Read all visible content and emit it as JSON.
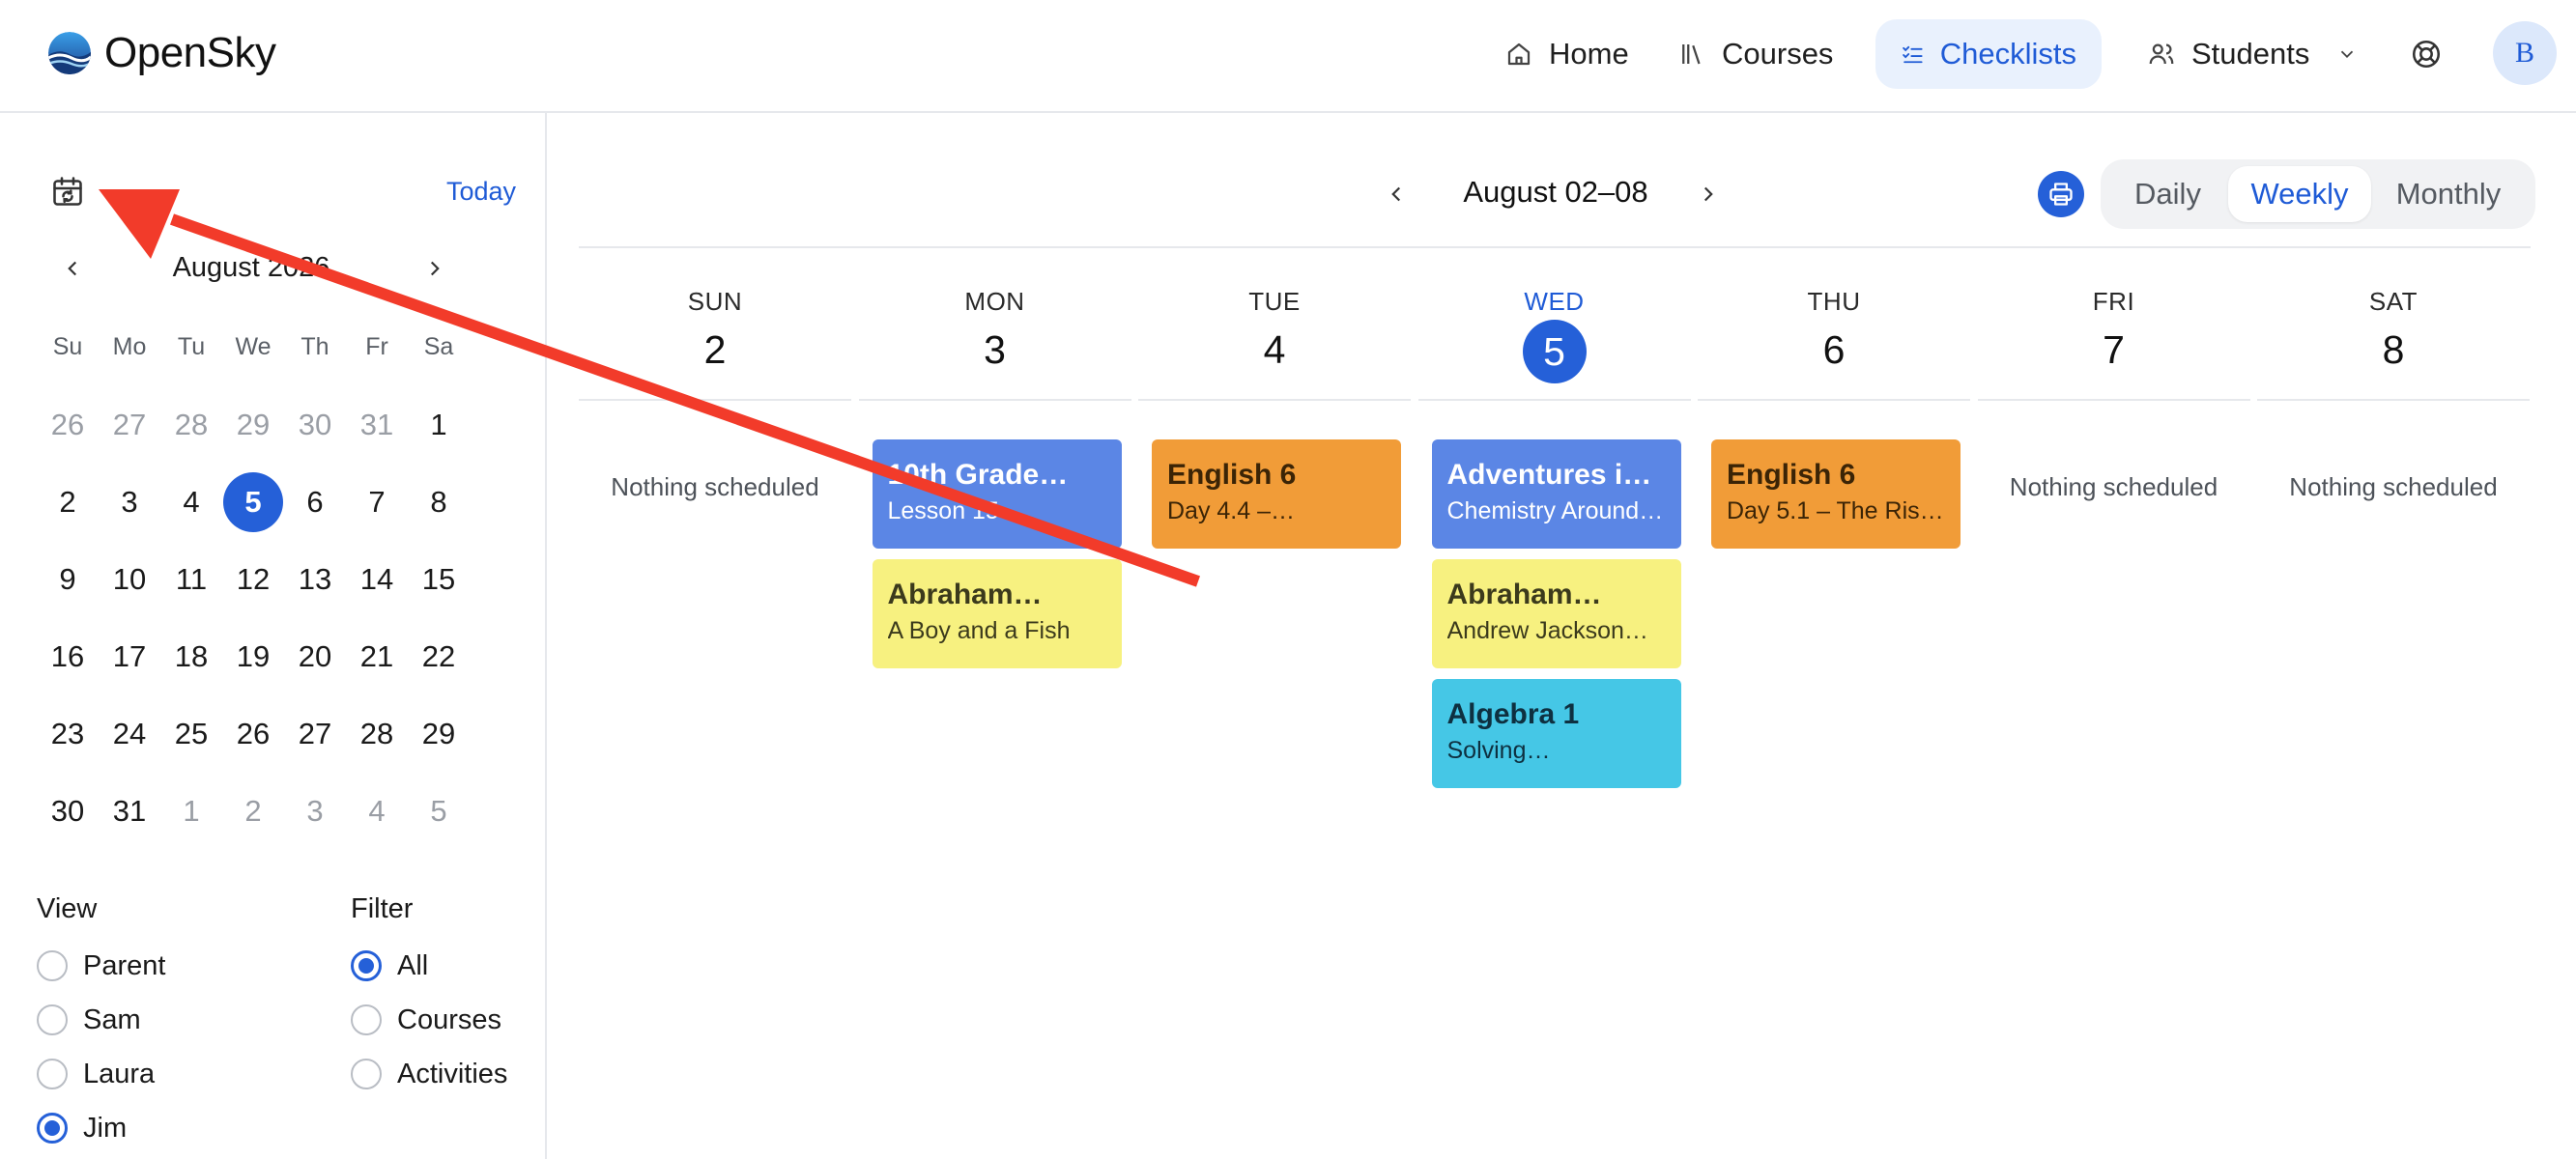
{
  "header": {
    "brand": "OpenSky",
    "nav": {
      "home": "Home",
      "courses": "Courses",
      "checklists": "Checklists",
      "students": "Students"
    },
    "avatar_initial": "B"
  },
  "sidebar": {
    "today_label": "Today",
    "month_title": "August 2026",
    "weekday_headers": [
      "Su",
      "Mo",
      "Tu",
      "We",
      "Th",
      "Fr",
      "Sa"
    ],
    "weeks": [
      [
        {
          "d": "26",
          "muted": true
        },
        {
          "d": "27",
          "muted": true
        },
        {
          "d": "28",
          "muted": true
        },
        {
          "d": "29",
          "muted": true
        },
        {
          "d": "30",
          "muted": true
        },
        {
          "d": "31",
          "muted": true
        },
        {
          "d": "1"
        }
      ],
      [
        {
          "d": "2"
        },
        {
          "d": "3"
        },
        {
          "d": "4"
        },
        {
          "d": "5",
          "selected": true
        },
        {
          "d": "6"
        },
        {
          "d": "7"
        },
        {
          "d": "8"
        }
      ],
      [
        {
          "d": "9"
        },
        {
          "d": "10"
        },
        {
          "d": "11"
        },
        {
          "d": "12"
        },
        {
          "d": "13"
        },
        {
          "d": "14"
        },
        {
          "d": "15"
        }
      ],
      [
        {
          "d": "16"
        },
        {
          "d": "17"
        },
        {
          "d": "18"
        },
        {
          "d": "19"
        },
        {
          "d": "20"
        },
        {
          "d": "21"
        },
        {
          "d": "22"
        }
      ],
      [
        {
          "d": "23"
        },
        {
          "d": "24"
        },
        {
          "d": "25"
        },
        {
          "d": "26"
        },
        {
          "d": "27"
        },
        {
          "d": "28"
        },
        {
          "d": "29"
        }
      ],
      [
        {
          "d": "30"
        },
        {
          "d": "31"
        },
        {
          "d": "1",
          "muted": true
        },
        {
          "d": "2",
          "muted": true
        },
        {
          "d": "3",
          "muted": true
        },
        {
          "d": "4",
          "muted": true
        },
        {
          "d": "5",
          "muted": true
        }
      ]
    ],
    "view": {
      "title": "View",
      "options": [
        {
          "label": "Parent",
          "checked": false
        },
        {
          "label": "Sam",
          "checked": false
        },
        {
          "label": "Laura",
          "checked": false
        },
        {
          "label": "Jim",
          "checked": true
        }
      ]
    },
    "filter": {
      "title": "Filter",
      "options": [
        {
          "label": "All",
          "checked": true
        },
        {
          "label": "Courses",
          "checked": false
        },
        {
          "label": "Activities",
          "checked": false
        }
      ]
    }
  },
  "main": {
    "week_title": "August 02–08",
    "views": {
      "daily": "Daily",
      "weekly": "Weekly",
      "monthly": "Monthly",
      "active": "Weekly"
    },
    "days": [
      {
        "dow": "SUN",
        "num": "2",
        "today": false,
        "empty_text": "Nothing scheduled",
        "events": []
      },
      {
        "dow": "MON",
        "num": "3",
        "today": false,
        "events": [
          {
            "title": "10th Grade…",
            "sub": "Lesson 15",
            "color": "blue"
          },
          {
            "title": "Abraham…",
            "sub": "A Boy and a Fish",
            "color": "yellow"
          }
        ]
      },
      {
        "dow": "TUE",
        "num": "4",
        "today": false,
        "events": [
          {
            "title": "English 6",
            "sub": "Day 4.4 –…",
            "color": "orange"
          }
        ]
      },
      {
        "dow": "WED",
        "num": "5",
        "today": true,
        "events": [
          {
            "title": "Adventures in…",
            "sub": "Chemistry Around…",
            "color": "blue"
          },
          {
            "title": "Abraham…",
            "sub": "Andrew Jackson…",
            "color": "yellow"
          },
          {
            "title": "Algebra 1",
            "sub": "Solving…",
            "color": "cyan"
          }
        ]
      },
      {
        "dow": "THU",
        "num": "6",
        "today": false,
        "events": [
          {
            "title": "English 6",
            "sub": "Day 5.1 – The Rise …",
            "color": "orange"
          }
        ]
      },
      {
        "dow": "FRI",
        "num": "7",
        "today": false,
        "empty_text": "Nothing scheduled",
        "events": []
      },
      {
        "dow": "SAT",
        "num": "8",
        "today": false,
        "empty_text": "Nothing scheduled",
        "events": []
      }
    ]
  },
  "colors": {
    "accent": "#2560d8",
    "event_blue": "#5b86e5",
    "event_orange": "#f19c38",
    "event_yellow": "#f7f180",
    "event_cyan": "#45c7e6",
    "annotation_arrow": "#f23b2a"
  },
  "icons": {
    "calendar_picker": "calendar-sync-icon",
    "home": "home-icon",
    "courses": "books-icon",
    "checklists": "checklist-icon",
    "students": "users-icon",
    "help": "lifebuoy-icon",
    "print": "printer-icon"
  }
}
